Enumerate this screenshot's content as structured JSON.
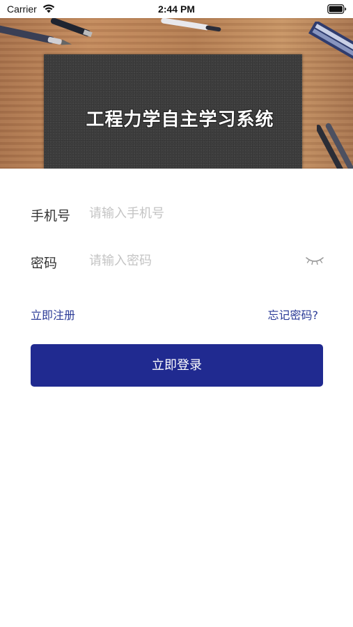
{
  "status_bar": {
    "carrier": "Carrier",
    "time": "2:44 PM",
    "icons": [
      "wifi-icon",
      "battery-icon"
    ]
  },
  "banner": {
    "title": "工程力学自主学习系统"
  },
  "form": {
    "phone": {
      "label": "手机号",
      "placeholder": "请输入手机号",
      "value": ""
    },
    "password": {
      "label": "密码",
      "placeholder": "请输入密码",
      "value": "",
      "toggle_icon": "eye-closed-icon"
    }
  },
  "links": {
    "register": "立即注册",
    "forgot": "忘记密码?"
  },
  "login_button": "立即登录",
  "colors": {
    "primary": "#202a90",
    "link": "#2a3a96",
    "placeholder": "#c4c4c4",
    "label": "#333333",
    "chalkboard": "#3e3e3e",
    "wood": "#b47d52"
  }
}
